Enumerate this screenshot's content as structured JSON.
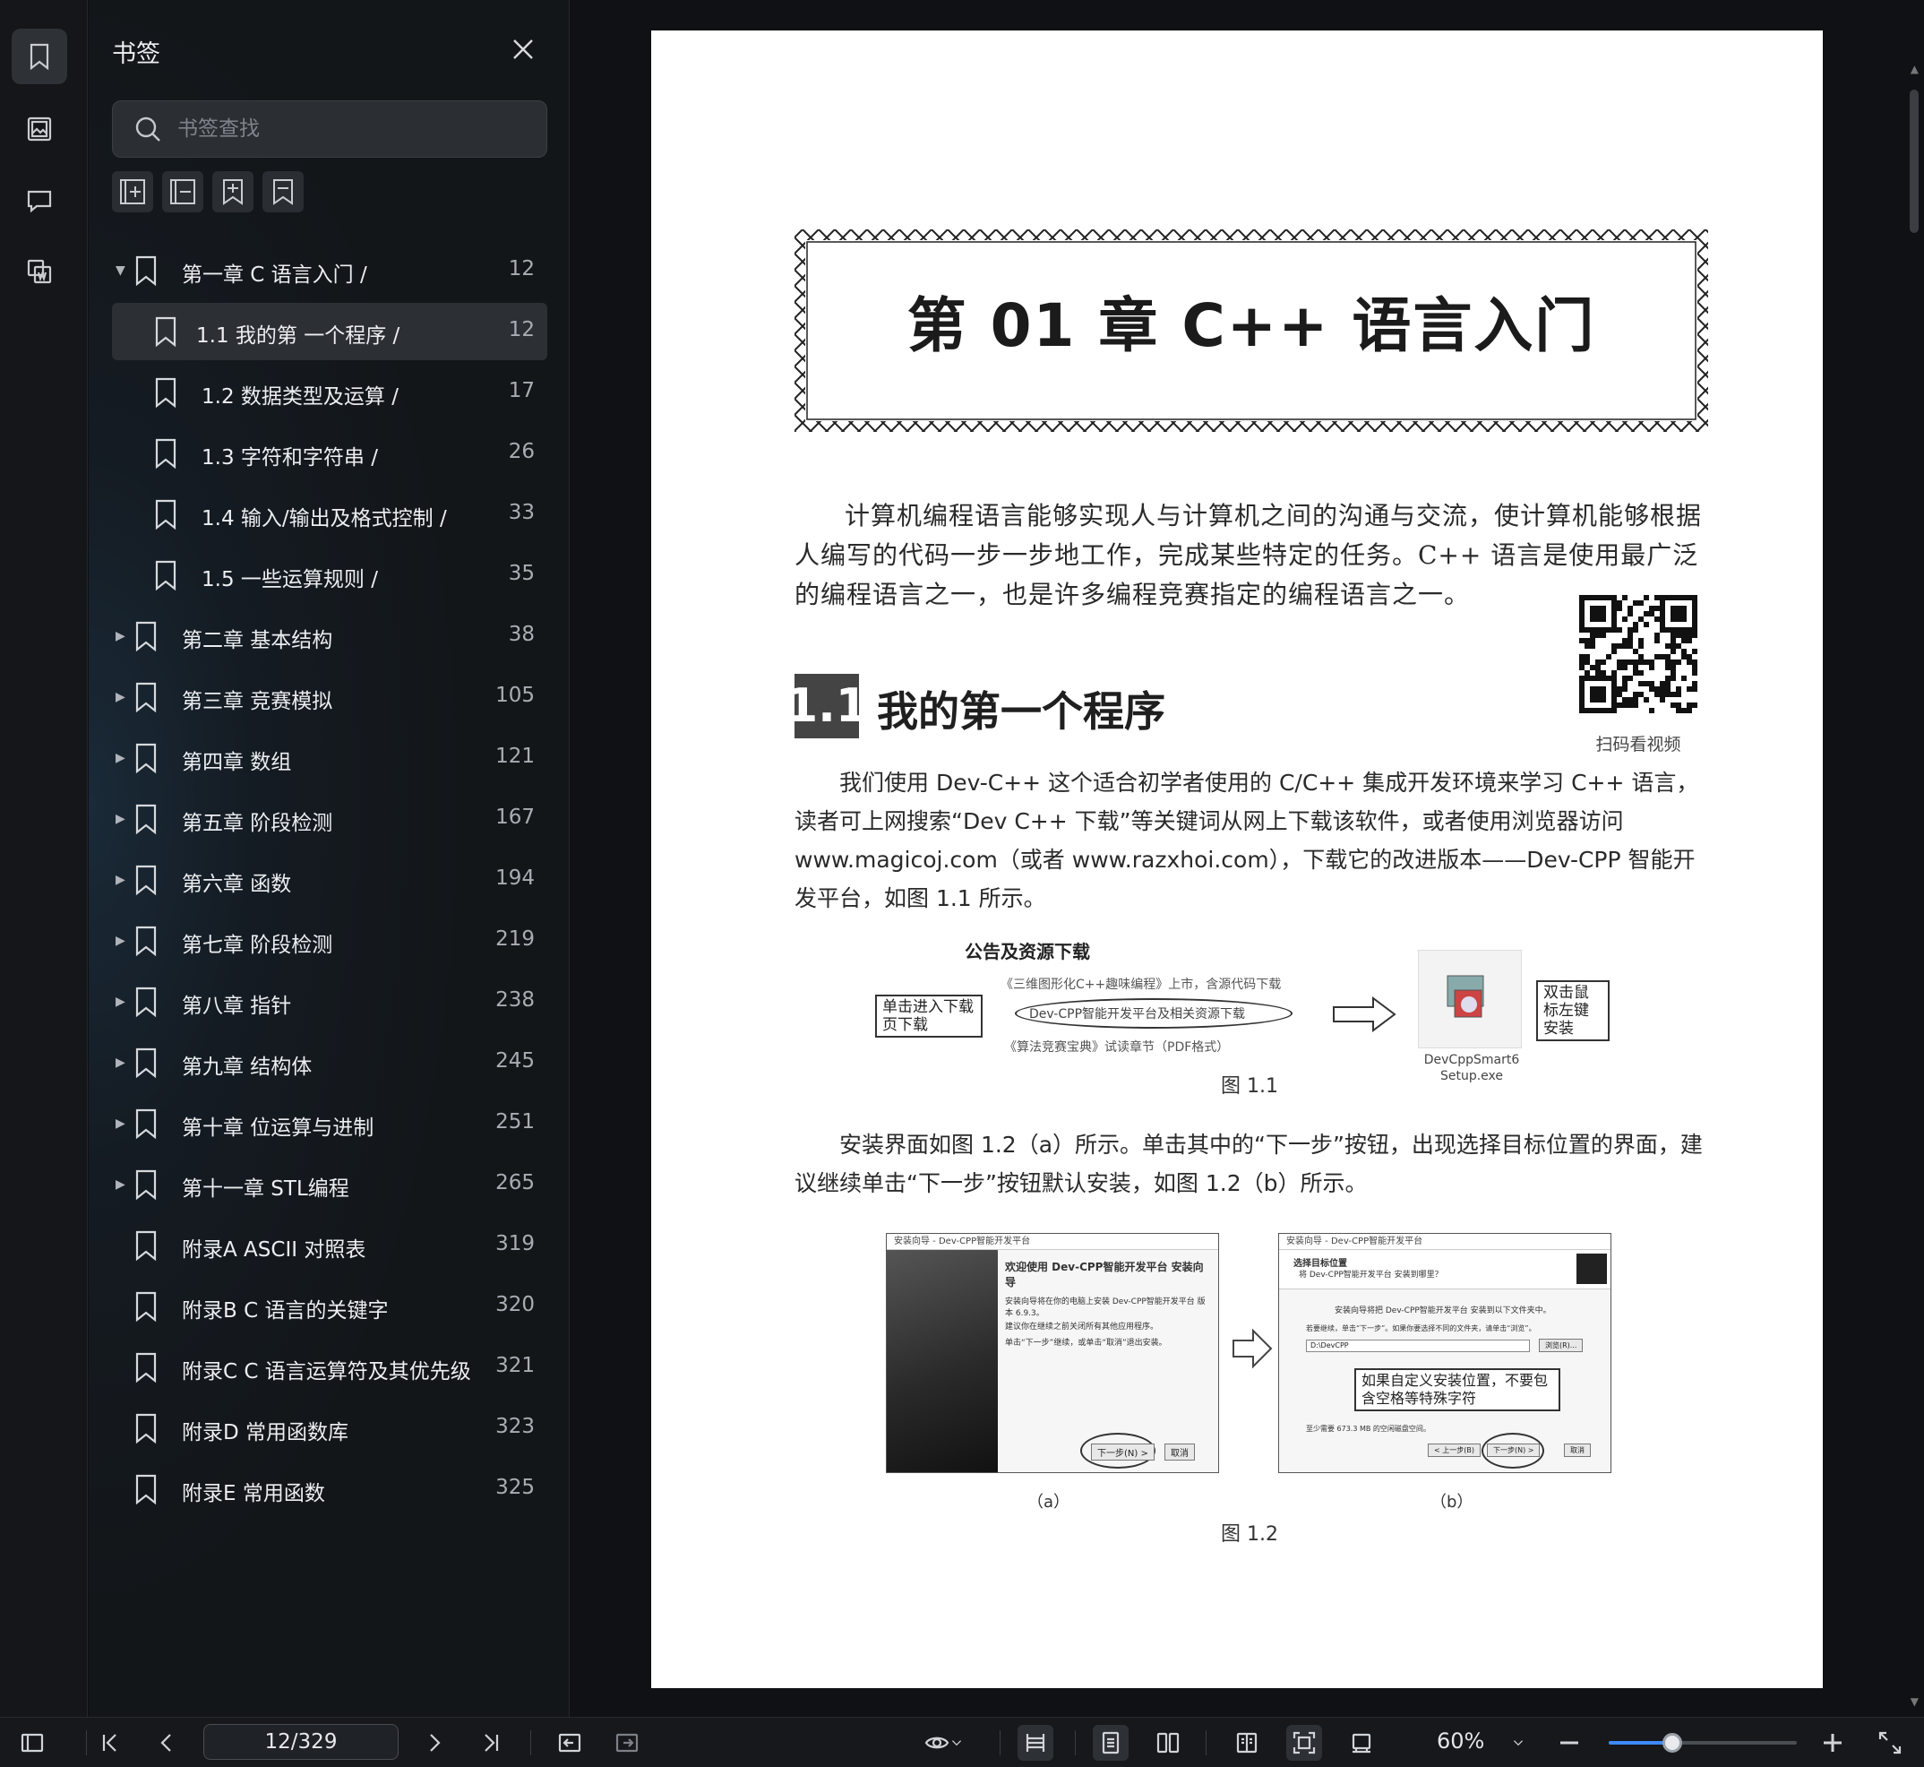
{
  "panel": {
    "title": "书签",
    "search_placeholder": "书签查找"
  },
  "bookmarks": [
    {
      "label": "第一章 C 语言入门   /",
      "page": "12",
      "level": 0,
      "expanded": true,
      "selected": false
    },
    {
      "label": "1.1 我的第 一个程序   /",
      "page": "12",
      "level": 1,
      "selected": true
    },
    {
      "label": "1.2 数据类型及运算   /",
      "page": "17",
      "level": 1
    },
    {
      "label": "1.3 字符和字符串   /",
      "page": "26",
      "level": 1
    },
    {
      "label": "1.4 输入/输出及格式控制   /",
      "page": "33",
      "level": 1
    },
    {
      "label": "1.5 一些运算规则   /",
      "page": "35",
      "level": 1
    },
    {
      "label": "第二章 基本结构",
      "page": "38",
      "level": 0,
      "collapsed": true
    },
    {
      "label": "第三章 竞赛模拟",
      "page": "105",
      "level": 0,
      "collapsed": true
    },
    {
      "label": "第四章 数组",
      "page": "121",
      "level": 0,
      "collapsed": true
    },
    {
      "label": "第五章 阶段检测",
      "page": "167",
      "level": 0,
      "collapsed": true
    },
    {
      "label": "第六章 函数",
      "page": "194",
      "level": 0,
      "collapsed": true
    },
    {
      "label": "第七章 阶段检测",
      "page": "219",
      "level": 0,
      "collapsed": true
    },
    {
      "label": "第八章 指针",
      "page": "238",
      "level": 0,
      "collapsed": true
    },
    {
      "label": "第九章 结构体",
      "page": "245",
      "level": 0,
      "collapsed": true
    },
    {
      "label": "第十章 位运算与进制",
      "page": "251",
      "level": 0,
      "collapsed": true
    },
    {
      "label": "第十一章 STL编程",
      "page": "265",
      "level": 0,
      "collapsed": true
    },
    {
      "label": "附录A ASCII 对照表",
      "page": "319",
      "level": 0
    },
    {
      "label": "附录B C 语言的关键字",
      "page": "320",
      "level": 0
    },
    {
      "label": "附录C C 语言运算符及其优先级",
      "page": "321",
      "level": 0
    },
    {
      "label": "附录D 常用函数库",
      "page": "323",
      "level": 0
    },
    {
      "label": "附录E 常用函数",
      "page": "325",
      "level": 0
    }
  ],
  "page": {
    "chapter_title": "第 01 章   C++ 语言入门",
    "intro": "计算机编程语言能够实现人与计算机之间的沟通与交流，使计算机能够根据人编写的代码一步一步地工作，完成某些特定的任务。C++ 语言是使用最广泛的编程语言之一，也是许多编程竞赛指定的编程语言之一。",
    "qr_caption": "扫码看视频",
    "section_num": "1.1",
    "section_title": "我的第一个程序",
    "para1": "我们使用 Dev-C++ 这个适合初学者使用的 C/C++ 集成开发环境来学习 C++ 语言，读者可上网搜索“Dev C++ 下载”等关键词从网上下载该软件，或者使用浏览器访问 www.magicoj.com（或者 www.razxhoi.com），下载它的改进版本——Dev-CPP 智能开发平台，如图 1.1 所示。",
    "fig1": {
      "heading": "公告及资源下载",
      "line1": "《三维图形化C++趣味编程》上市，含源代码下载",
      "line2": "Dev-CPP智能开发平台及相关资源下载",
      "line3": "《算法竞赛宝典》试读章节（PDF格式）",
      "callout_left": "单击进入下载页下载",
      "callout_right": "双击鼠标左键安装",
      "exe_name": "DevCppSmart6 Setup.exe",
      "caption": "图 1.1"
    },
    "para2": "安装界面如图 1.2（a）所示。单击其中的“下一步”按钮，出现选择目标位置的界面，建议继续单击“下一步”按钮默认安装，如图 1.2（b）所示。",
    "fig2": {
      "a_title": "安装向导 - Dev-CPP智能开发平台",
      "a_heading": "欢迎使用 Dev-CPP智能开发平台 安装向导",
      "a_text1": "安装向导将在你的电脑上安装 Dev-CPP智能开发平台 版本 6.9.3。",
      "a_text2": "建议你在继续之前关闭所有其他应用程序。",
      "a_text3": "单击“下一步”继续，或单击“取消”退出安装。",
      "a_next": "下一步(N) >",
      "a_cancel": "取消",
      "a_label": "（a）",
      "b_title": "安装向导 - Dev-CPP智能开发平台",
      "b_heading": "选择目标位置",
      "b_sub": "将 Dev-CPP智能开发平台 安装到哪里？",
      "b_text1": "安装向导将把 Dev-CPP智能开发平台 安装到以下文件夹中。",
      "b_text2": "若要继续，单击“下一步”。如果你要选择不同的文件夹，请单击“浏览”。",
      "b_path": "D:\\DevCPP",
      "b_browse": "浏览(R)...",
      "b_callout": "如果自定义安装位置，不要包含空格等特殊字符",
      "b_space": "至少需要 673.3 MB 的空闲磁盘空间。",
      "b_back": "< 上一步(B)",
      "b_next": "下一步(N) >",
      "b_cancel": "取消",
      "b_label": "（b）",
      "caption": "图 1.2"
    }
  },
  "statusbar": {
    "page_indicator": "12/329",
    "zoom": "60%",
    "zoom_slider_fraction": 0.34
  },
  "colors": {
    "accent": "#3d8bff",
    "panel_bg": "#131619",
    "selected_row": "#2c2f34"
  }
}
